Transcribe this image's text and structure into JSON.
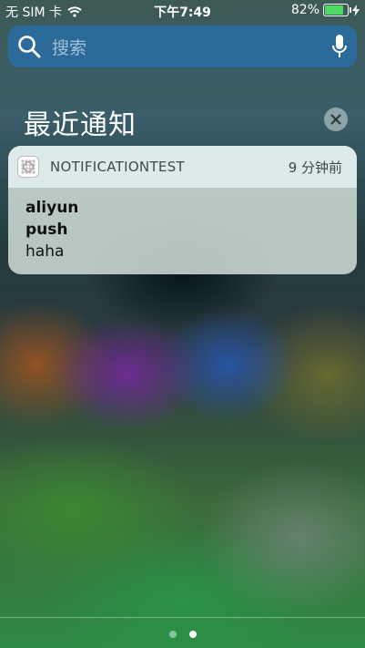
{
  "status_bar": {
    "carrier": "无 SIM 卡",
    "time": "下午7:49",
    "battery_percent": "82%",
    "battery_level": 0.82,
    "battery_color": "#4cd964"
  },
  "search": {
    "placeholder": "搜索",
    "icons": [
      "search-icon",
      "microphone-icon"
    ]
  },
  "section": {
    "title": "最近通知",
    "clear_icon": "close-icon"
  },
  "notifications": [
    {
      "app_name": "NOTIFICATIONTEST",
      "time": "9 分钟前",
      "title_line1": "aliyun",
      "title_line2": "push",
      "body": "haha"
    }
  ],
  "page_indicator": {
    "count": 2,
    "active_index": 1
  }
}
